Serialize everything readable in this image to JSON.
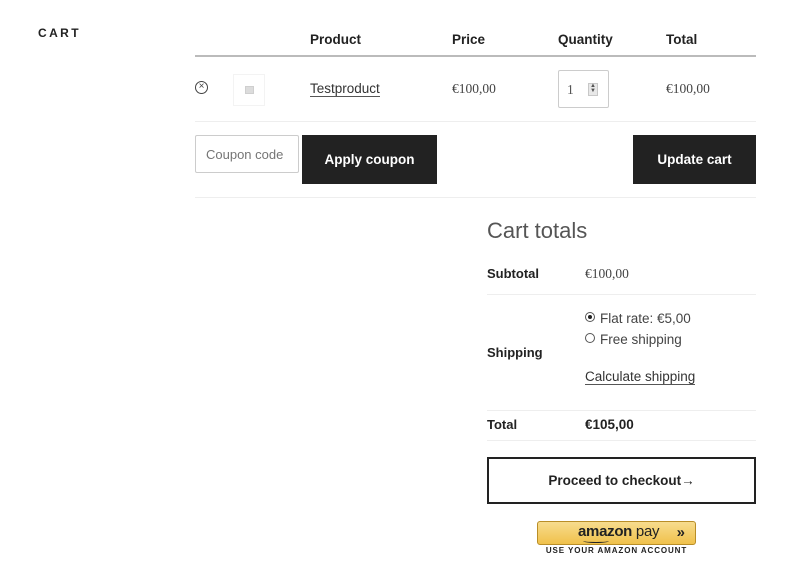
{
  "page": {
    "heading": "CART"
  },
  "cart_table": {
    "columns": [
      "Product",
      "Price",
      "Quantity",
      "Total"
    ],
    "rows": [
      {
        "product": "Testproduct",
        "price": "€100,00",
        "quantity": "1",
        "total": "€100,00",
        "remove_icon": "remove-circle-x-icon",
        "thumbnail_icon": "image-placeholder-icon"
      }
    ]
  },
  "actions": {
    "coupon_placeholder": "Coupon code",
    "apply_coupon_label": "Apply coupon",
    "update_cart_label": "Update cart"
  },
  "cart_totals": {
    "title": "Cart totals",
    "subtotal_label": "Subtotal",
    "subtotal_value": "€100,00",
    "shipping_label": "Shipping",
    "shipping_options": [
      {
        "label": "Flat rate: €5,00",
        "selected": true
      },
      {
        "label": "Free shipping",
        "selected": false
      }
    ],
    "calculate_shipping_label": "Calculate shipping",
    "total_label": "Total",
    "total_value": "€105,00"
  },
  "checkout": {
    "proceed_label": "Proceed to checkout→",
    "amazon_pay": {
      "logo_amazon": "amazon",
      "logo_pay": " pay",
      "chevron": "»",
      "caption": "USE YOUR AMAZON ACCOUNT"
    }
  }
}
